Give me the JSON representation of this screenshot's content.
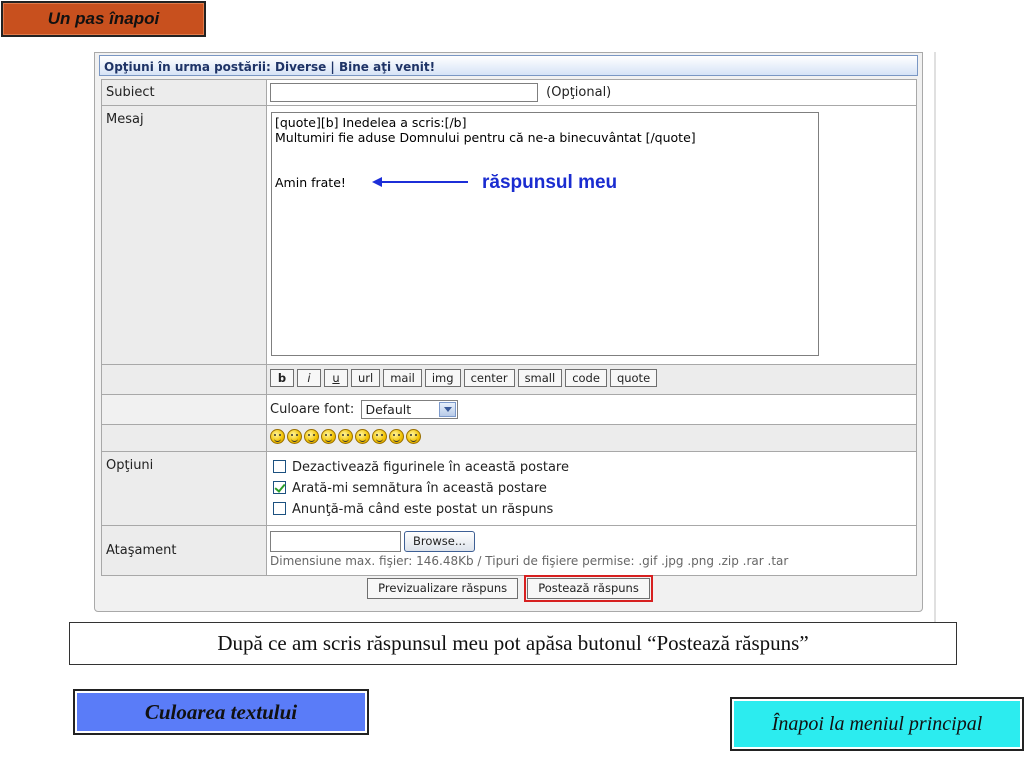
{
  "nav": {
    "back_label": "Un pas înapoi",
    "color_label": "Culoarea textului",
    "menu_label": "Înapoi la meniul principal"
  },
  "colors": {
    "back_bg": "#c8501e",
    "color_btn_bg": "#5a7cf8",
    "menu_btn_bg": "#2cecef",
    "annotation": "#1a2cd0",
    "highlight": "#d72020"
  },
  "form": {
    "header": "Opţiuni în urma postării: Diverse | Bine aţi venit!",
    "subject_label": "Subiect",
    "subject_value": "",
    "subject_optional": "(Opţional)",
    "message_label": "Mesaj",
    "message_lines": {
      "line1": "[quote][b] Inedelea a scris:[/b]",
      "line2": "Multumiri fie aduse Domnului pentru că ne-a binecuvântat [/quote]",
      "line3": "Amin frate!"
    },
    "annotation": "răspunsul meu",
    "bbcode_buttons": {
      "b": "b",
      "i": "i",
      "u": "u",
      "url": "url",
      "mail": "mail",
      "img": "img",
      "center": "center",
      "small": "small",
      "code": "code",
      "quote": "quote"
    },
    "font_color_label": "Culoare font:",
    "font_color_value": "Default",
    "smiley_count": 9,
    "options_label": "Opţiuni",
    "options": {
      "opt1": {
        "label": "Dezactivează figurinele în această postare",
        "checked": false
      },
      "opt2": {
        "label": "Arată-mi semnătura în această postare",
        "checked": true
      },
      "opt3": {
        "label": "Anunţă-mă când este postat un răspuns",
        "checked": false
      }
    },
    "attachment_label": "Ataşament",
    "browse_label": "Browse...",
    "attachment_note": "Dimensiune max. fişier: 146.48Kb / Tipuri de fişiere permise: .gif .jpg .png .zip .rar .tar",
    "preview_label": "Previzualizare răspuns",
    "post_label": "Postează răspuns"
  },
  "caption": "După ce am scris răspunsul meu pot apăsa butonul “Postează răspuns”"
}
